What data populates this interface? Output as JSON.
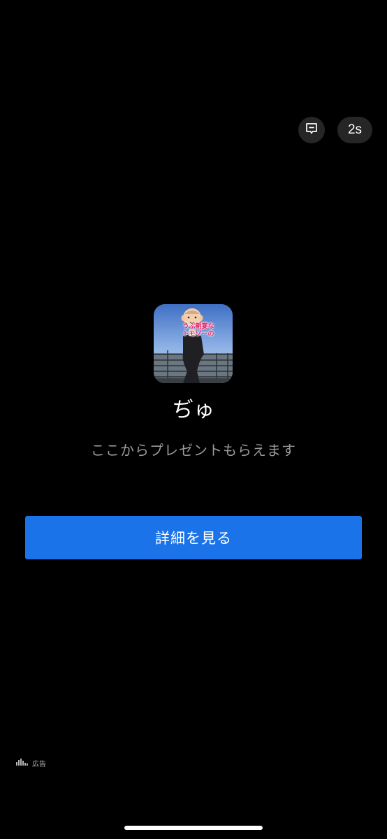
{
  "controls": {
    "feedback_icon": "message-square-icon",
    "timer_label": "2s"
  },
  "app": {
    "thumbnail_caption_line1": "うぶ朝宴な",
    "thumbnail_caption_line2": "トモゾーの",
    "name": "ぢゅ",
    "subtitle": "ここからプレゼントもらえます"
  },
  "cta": {
    "label": "詳細を見る"
  },
  "footer": {
    "ad_icon": "ad-choices-icon",
    "ad_label": "広告"
  },
  "colors": {
    "background": "#000000",
    "cta": "#1a73e8",
    "subtitle": "#9a9a9a"
  }
}
